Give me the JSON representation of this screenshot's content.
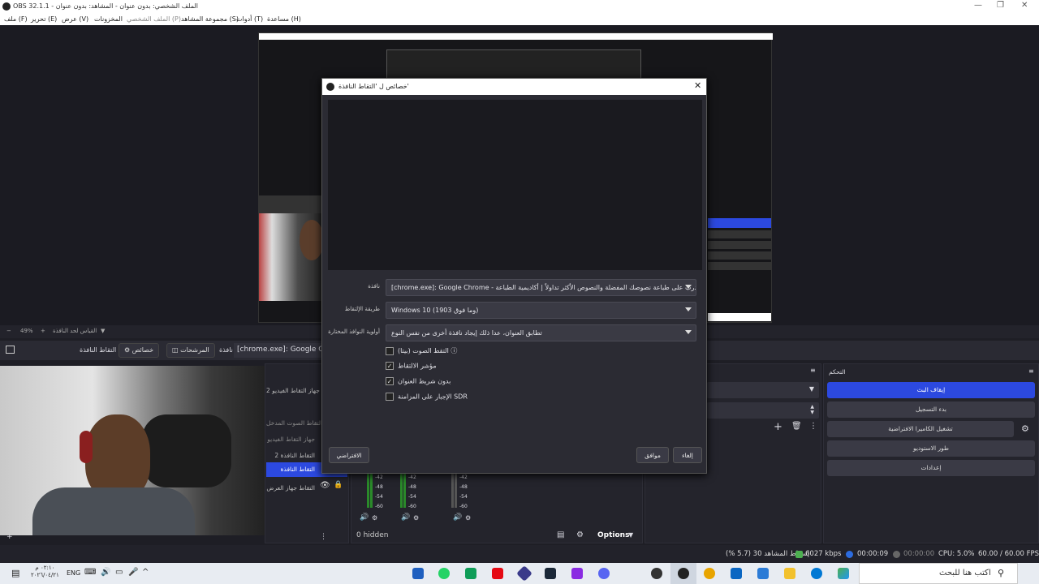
{
  "window": {
    "title": "OBS 32.1.1 - الملف الشخصي: بدون عنوان - المشاهد: بدون عنوان"
  },
  "menu": [
    "ملف (F)",
    "تحرير (E)",
    "عرض (V)",
    "المخزونات",
    "الملف الشخصي (P)",
    "مجموعة المشاهد (S)",
    "أدوات (T)",
    "مساعدة (H)"
  ],
  "zoom": {
    "value": "49%",
    "label": "القياس لحد النافذة"
  },
  "source_toolbar": {
    "source_name": "التقاط النافذة",
    "properties_label": "خصائص",
    "filters_label": "المرشحات",
    "window_label": "نافذة",
    "window_value": "[chrome.exe]: Google Chrome"
  },
  "sources": {
    "items": [
      "جهاز التقاط الفيديو 2",
      "",
      "التقاط الصوت المدخل",
      "جهاز التقاط الفيديو",
      "التقاط النافذة 2",
      "التقاط النافذة",
      "التقاط جهاز العرض"
    ]
  },
  "mixer": {
    "hidden_label": "0 hidden",
    "options_label": "Options",
    "ticks": [
      "-42",
      "-48",
      "-54",
      "-60"
    ]
  },
  "controls": {
    "header": "التحكم",
    "buttons": [
      "إيقاف البث",
      "بدء التسجيل",
      "تشغيل الكاميرا الافتراضية",
      "طور الاستوديو",
      "إعدادات"
    ],
    "accent": "#2c49e0"
  },
  "status": {
    "dropped": "إسقاط المشاهد 30 (5.7 %)",
    "bitrate": "6027 kbps",
    "stream_time": "00:00:09",
    "rec_time": "00:00:00",
    "cpu": "CPU: 5.0%",
    "fps": "60.00 / 60.00 FPS"
  },
  "dialog": {
    "title": "خصائص ل 'التقاط النافذة'",
    "window_label": "نافذة",
    "window_value": "[chrome.exe]: Google Chrome - تدرب على طباعة نصوصك المفضلة والنصوص الأكثر تداولاً | أكاديمية الطباعة",
    "method_label": "طريقة الإلتقاط",
    "method_value": "Windows 10 (1903 وما فوق)",
    "priority_label": "أولوية النوافذ المختارة",
    "priority_value": "تطابق العنوان، عدا ذلك إيجاد نافذة أخرى من نفس النوع",
    "checkboxes": [
      {
        "label": "التقط الصوت (بيتا)",
        "checked": false
      },
      {
        "label": "مؤشر الالتقاط",
        "checked": true
      },
      {
        "label": "بدون شريط العنوان",
        "checked": true
      },
      {
        "label": "الإجبار على المزامنة SDR",
        "checked": false
      }
    ],
    "defaults_label": "الافتراضي",
    "ok_label": "موافق",
    "cancel_label": "إلغاء"
  },
  "taskbar": {
    "search_placeholder": "اكتب هنا للبحث",
    "lang": "ENG",
    "time": "٠٢:١٠ م",
    "date": "٢٠٢٦/٠٤/٢١"
  }
}
